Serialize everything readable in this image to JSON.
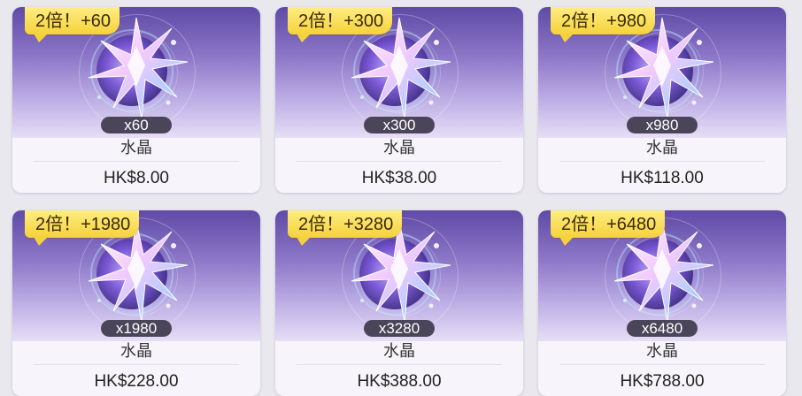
{
  "products": [
    {
      "badge": "2倍！+60",
      "quantity": "x60",
      "name": "水晶",
      "price": "HK$8.00"
    },
    {
      "badge": "2倍！+300",
      "quantity": "x300",
      "name": "水晶",
      "price": "HK$38.00"
    },
    {
      "badge": "2倍！+980",
      "quantity": "x980",
      "name": "水晶",
      "price": "HK$118.00"
    },
    {
      "badge": "2倍！+1980",
      "quantity": "x1980",
      "name": "水晶",
      "price": "HK$228.00"
    },
    {
      "badge": "2倍！+3280",
      "quantity": "x3280",
      "name": "水晶",
      "price": "HK$388.00"
    },
    {
      "badge": "2倍！+6480",
      "quantity": "x6480",
      "name": "水晶",
      "price": "HK$788.00"
    }
  ],
  "colors": {
    "badge": "#f6d23a",
    "card_gradient_top": "#5f4aa6",
    "card_gradient_bottom": "#e6def6",
    "quantity_pill": "#4a4558"
  },
  "icons": {
    "crystal": "crystal-icon"
  }
}
